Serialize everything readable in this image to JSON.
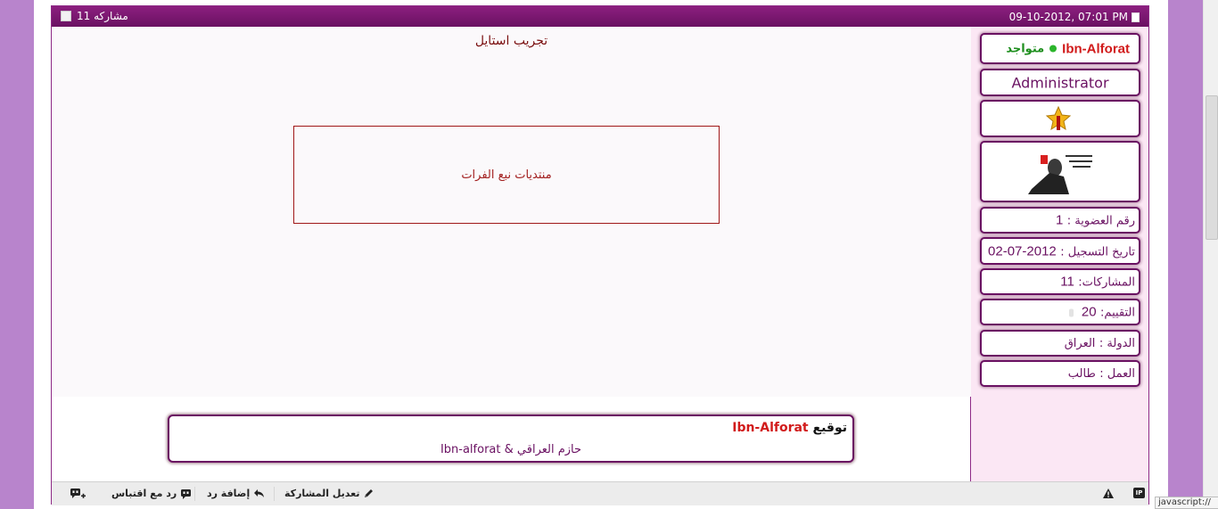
{
  "header": {
    "date": "09-10-2012, 07:01 PM",
    "post_count": "مشاركه 11"
  },
  "post": {
    "title": "تجريب استايل",
    "box_text": "منتديات نبع الفرات"
  },
  "signature": {
    "label": "توقيع",
    "username": "Ibn-Alforat",
    "text": "حازم العراقي & Ibn-alforat"
  },
  "user": {
    "name": "Ibn-Alforat",
    "status": "متواجد",
    "rank": "Administrator",
    "fields": [
      {
        "label": "رقم العضوية :",
        "value": "1"
      },
      {
        "label": "تاريخ التسجيل :",
        "value": "2012-07-02"
      },
      {
        "label": "المشاركات:",
        "value": "11"
      },
      {
        "label": "التقييم:",
        "value": "20"
      },
      {
        "label": "الدولة :",
        "value": "العراق"
      },
      {
        "label": "العمل :",
        "value": "طالب"
      }
    ]
  },
  "toolbar": {
    "edit": "تعديل المشاركة",
    "reply": "إضافة رد",
    "quote": "رد مع اقتباس"
  },
  "status_tip": "javascript://",
  "colors": {
    "accent": "#6a1162",
    "username": "#d11b1b",
    "online": "#2bb52b"
  }
}
